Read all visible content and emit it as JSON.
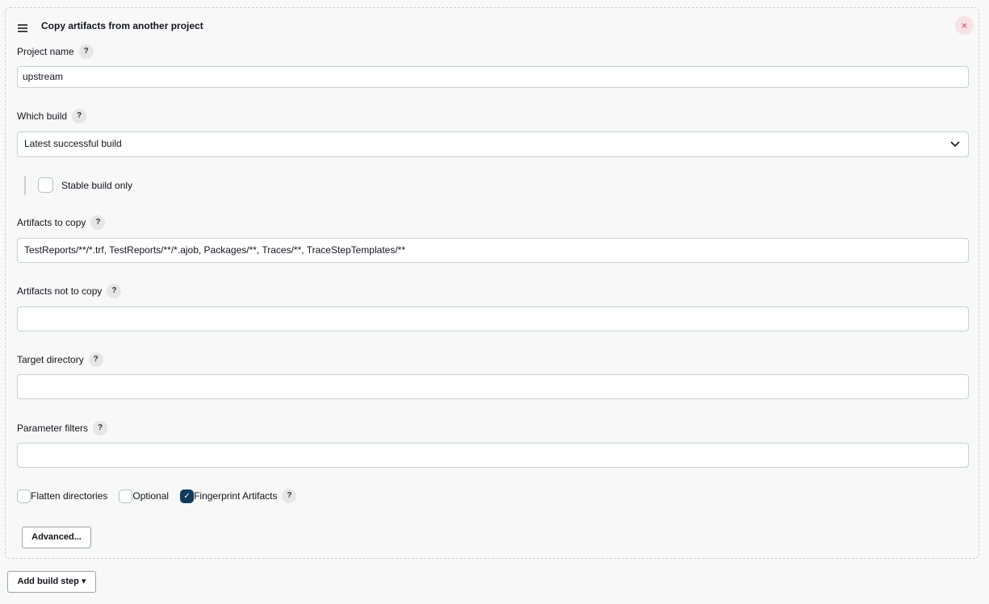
{
  "step": {
    "title": "Copy artifacts from another project",
    "close_icon": "×"
  },
  "fields": {
    "project_name": {
      "label": "Project name",
      "value": "upstream"
    },
    "which_build": {
      "label": "Which build",
      "selected": "Latest successful build"
    },
    "stable_only": {
      "label": "Stable build only",
      "checked": false
    },
    "artifacts_to_copy": {
      "label": "Artifacts to copy",
      "value": "TestReports/**/*.trf, TestReports/**/*.ajob, Packages/**, Traces/**, TraceStepTemplates/**"
    },
    "artifacts_not_to_copy": {
      "label": "Artifacts not to copy",
      "value": ""
    },
    "target_directory": {
      "label": "Target directory",
      "value": ""
    },
    "parameter_filters": {
      "label": "Parameter filters",
      "value": ""
    }
  },
  "options": {
    "flatten": {
      "label": "Flatten directories",
      "checked": false
    },
    "optional": {
      "label": "Optional",
      "checked": false
    },
    "fingerprint": {
      "label": "Fingerprint Artifacts",
      "checked": true
    }
  },
  "help_glyph": "?",
  "check_glyph": "✓",
  "chevron_glyph": "⌄",
  "buttons": {
    "advanced": "Advanced...",
    "add_build_step": "Add build step ▾"
  }
}
